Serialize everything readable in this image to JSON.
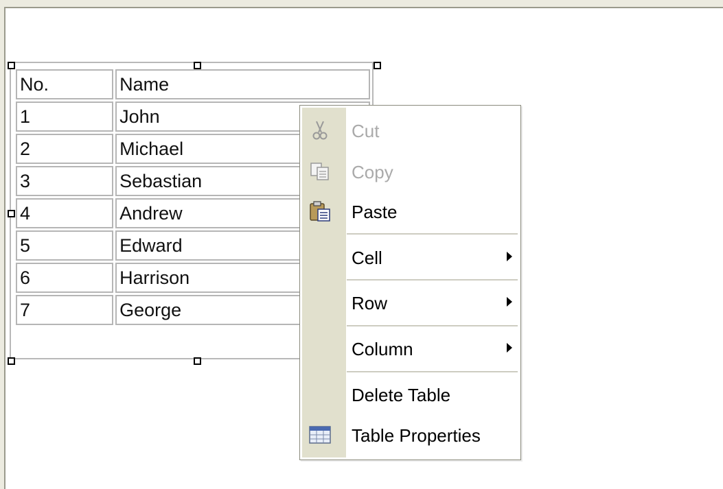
{
  "table": {
    "headers": [
      "No.",
      "Name"
    ],
    "rows": [
      [
        "1",
        "John"
      ],
      [
        "2",
        "Michael"
      ],
      [
        "3",
        "Sebastian"
      ],
      [
        "4",
        "Andrew"
      ],
      [
        "5",
        "Edward"
      ],
      [
        "6",
        "Harrison"
      ],
      [
        "7",
        "George"
      ]
    ]
  },
  "context_menu": {
    "items": [
      {
        "label": "Cut",
        "icon": "scissors-icon",
        "enabled": false,
        "submenu": false
      },
      {
        "label": "Copy",
        "icon": "copy-icon",
        "enabled": false,
        "submenu": false
      },
      {
        "label": "Paste",
        "icon": "paste-icon",
        "enabled": true,
        "submenu": false
      },
      {
        "label": "Cell",
        "icon": "",
        "enabled": true,
        "submenu": true
      },
      {
        "label": "Row",
        "icon": "",
        "enabled": true,
        "submenu": true
      },
      {
        "label": "Column",
        "icon": "",
        "enabled": true,
        "submenu": true
      },
      {
        "label": "Delete Table",
        "icon": "",
        "enabled": true,
        "submenu": false
      },
      {
        "label": "Table Properties",
        "icon": "table-properties-icon",
        "enabled": true,
        "submenu": false
      }
    ]
  },
  "colors": {
    "window_background": "#ecebe0",
    "menu_gutter": "#e1e0cd",
    "disabled_text": "#aaaaaa"
  }
}
